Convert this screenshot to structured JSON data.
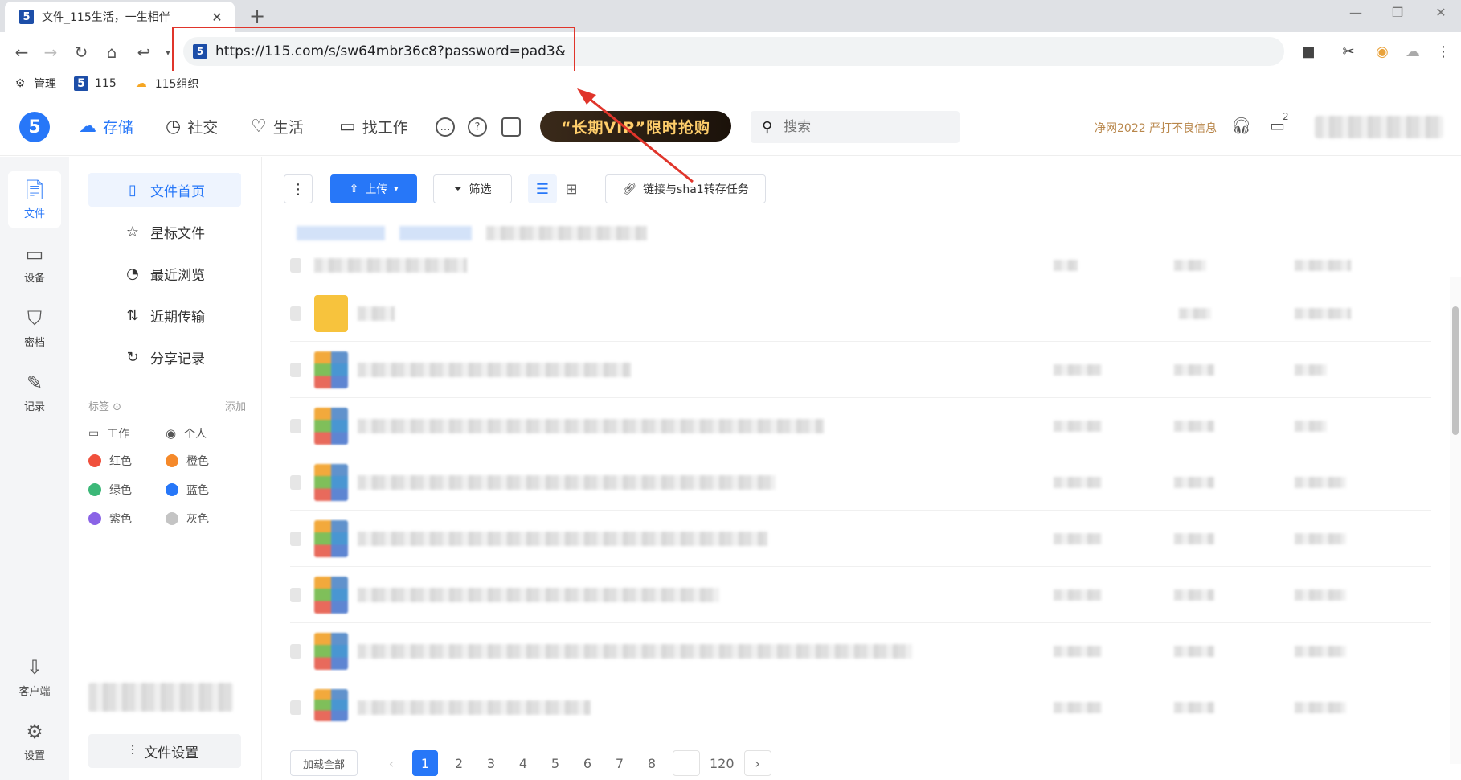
{
  "browser": {
    "tab_title": "文件_115生活，一生相伴",
    "tab_close": "✕",
    "new_tab": "+",
    "url": "https://115.com/s/sw64mbr36c8?password=pad3&",
    "bookmarks": [
      {
        "label": "管理",
        "icon": "gear-icon"
      },
      {
        "label": "115",
        "icon": "115-logo-icon"
      },
      {
        "label": "115组织",
        "icon": "cloud-icon"
      }
    ]
  },
  "header": {
    "logo": "5",
    "nav": [
      "存储",
      "社交",
      "生活",
      "找工作"
    ],
    "vip_banner": "“长期VIP”限时抢购",
    "search_placeholder": "搜索",
    "notice": "净网2022 严打不良信息",
    "device_badge": "2"
  },
  "rail": {
    "items": [
      "文件",
      "设备",
      "密档",
      "记录"
    ],
    "bottom": [
      "客户端",
      "设置"
    ]
  },
  "sidebar": {
    "items": [
      "文件首页",
      "星标文件",
      "最近浏览",
      "近期传输",
      "分享记录"
    ],
    "tags_label": "标签",
    "tags_add": "添加",
    "tags": [
      {
        "label": "工作",
        "color": ""
      },
      {
        "label": "个人",
        "color": ""
      },
      {
        "label": "红色",
        "color": "#f0503c"
      },
      {
        "label": "橙色",
        "color": "#f5892a"
      },
      {
        "label": "绿色",
        "color": "#3cb878"
      },
      {
        "label": "蓝色",
        "color": "#2777f8"
      },
      {
        "label": "紫色",
        "color": "#8a63e6"
      },
      {
        "label": "灰色",
        "color": "#c4c4c4"
      }
    ],
    "settings_label": "文件设置"
  },
  "toolbar": {
    "more": "⋮",
    "upload": "上传",
    "filter": "筛选",
    "link_task": "链接与sha1转存任务"
  },
  "pager": {
    "load_all": "加载全部",
    "prev": "‹",
    "pages": [
      "1",
      "2",
      "3",
      "4",
      "5",
      "6",
      "7",
      "8"
    ],
    "last": "120",
    "next": "›",
    "current": "1"
  },
  "colors": {
    "accent": "#2777f8",
    "highlight": "#e0352b"
  }
}
